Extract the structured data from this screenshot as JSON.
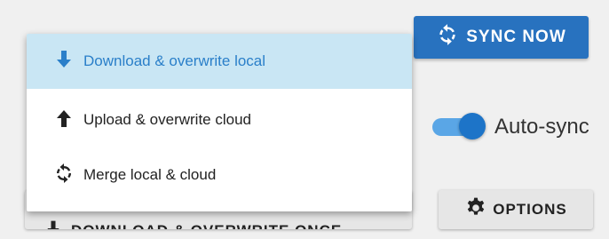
{
  "sync_button": {
    "label": "SYNC NOW",
    "icon": "sync-icon",
    "color": "#2872bf"
  },
  "auto_sync": {
    "label": "Auto-sync",
    "enabled": true,
    "accent": "#1d74c8"
  },
  "options_button": {
    "label": "OPTIONS",
    "icon": "gear-icon"
  },
  "download_once_button": {
    "label": "DOWNLOAD & OVERWRITE ONCE",
    "icon": "arrow-down-icon"
  },
  "dropdown": {
    "items": [
      {
        "label": "Download & overwrite local",
        "icon": "arrow-down-icon",
        "highlighted": true
      },
      {
        "label": "Upload & overwrite cloud",
        "icon": "arrow-up-icon",
        "highlighted": false
      },
      {
        "label": "Merge local & cloud",
        "icon": "sync-icon",
        "highlighted": false
      }
    ],
    "highlight_color": "#c9e6f4"
  }
}
